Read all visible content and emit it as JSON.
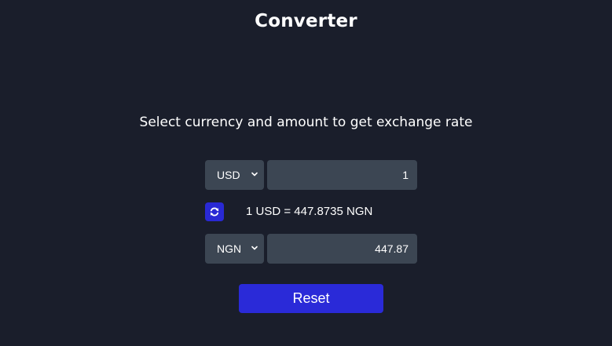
{
  "app": {
    "title": "Converter",
    "subtitle": "Select currency and amount to get exchange rate"
  },
  "from": {
    "currency": "USD",
    "amount": "1"
  },
  "to": {
    "currency": "NGN",
    "amount": "447.87"
  },
  "rate_text": "1 USD = 447.8735 NGN",
  "swap_icon": "refresh-icon",
  "reset_label": "Reset",
  "colors": {
    "background": "#1a1e2b",
    "field": "#3c4653",
    "accent": "#2a2ad8"
  }
}
